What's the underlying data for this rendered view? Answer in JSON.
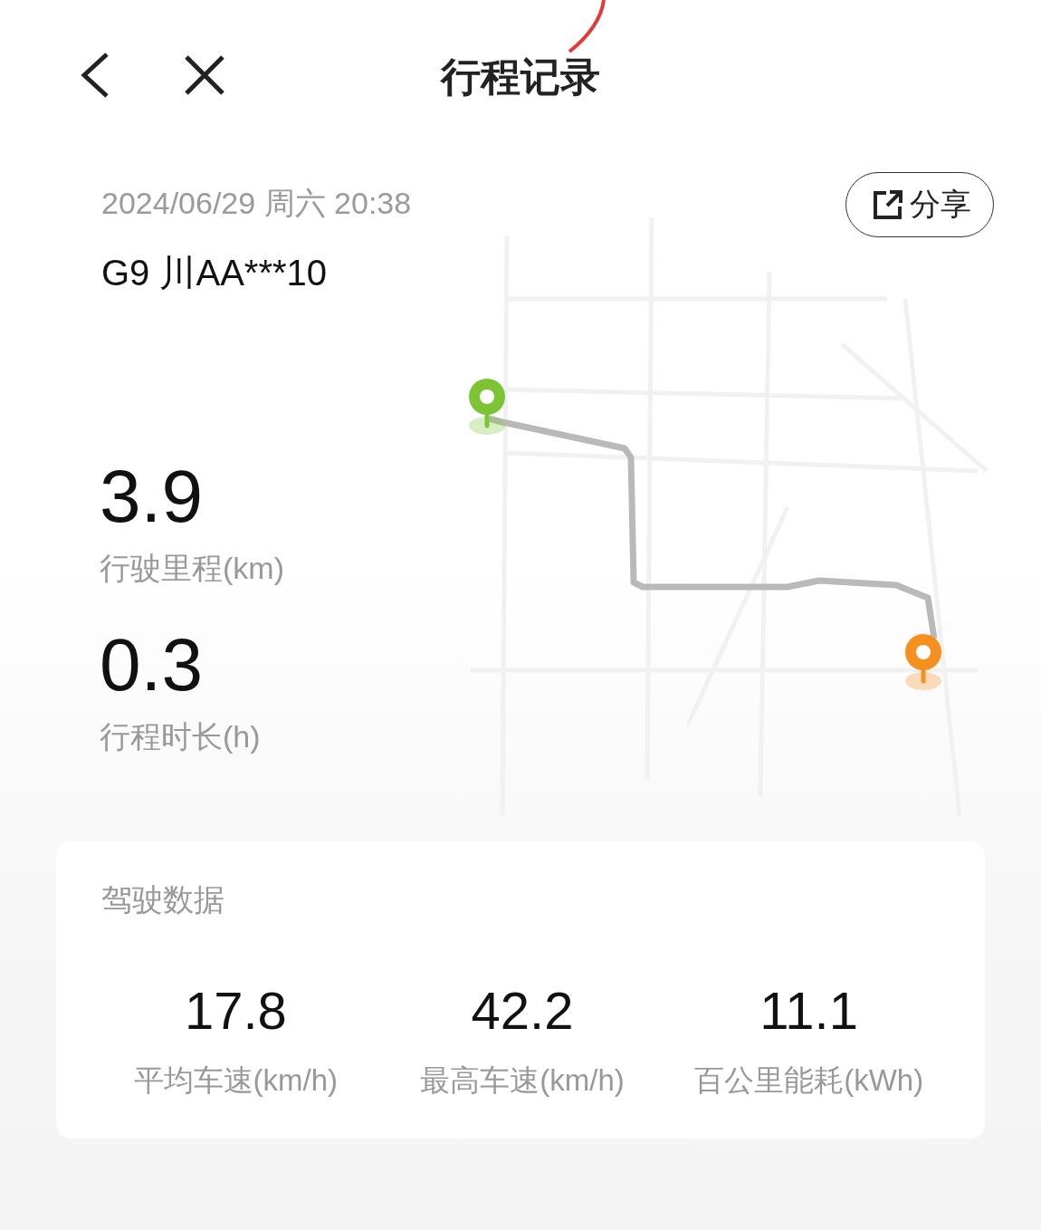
{
  "header": {
    "title": "行程记录"
  },
  "trip": {
    "datetime": "2024/06/29 周六 20:38",
    "vehicle": "G9 川AA***10",
    "share_button": "分享"
  },
  "stats": [
    {
      "value": "3.9",
      "label": "行驶里程(km)"
    },
    {
      "value": "0.3",
      "label": "行程时长(h)"
    }
  ],
  "driving_data": {
    "title": "驾驶数据",
    "metrics": [
      {
        "value": "17.8",
        "label": "平均车速(km/h)"
      },
      {
        "value": "42.2",
        "label": "最高车速(km/h)"
      },
      {
        "value": "11.1",
        "label": "百公里能耗(kWh)"
      }
    ]
  }
}
